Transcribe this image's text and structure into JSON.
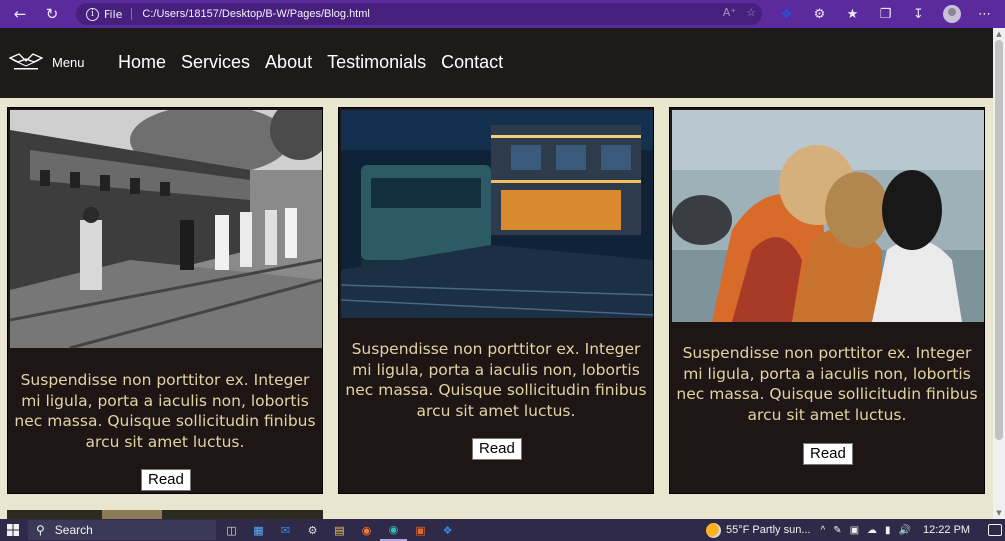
{
  "browser": {
    "file_label": "File",
    "url": "C:/Users/18157/Desktop/B-W/Pages/Blog.html",
    "icons": [
      "back-icon",
      "refresh-icon",
      "info-icon",
      "read-aloud-icon",
      "favorite-add-icon",
      "extension-icon",
      "extensions-icon",
      "favorites-icon",
      "collections-icon",
      "downloads-icon",
      "profile-icon",
      "more-icon"
    ]
  },
  "header": {
    "menu_label": "Menu",
    "nav": [
      "Home",
      "Services",
      "About",
      "Testimonials",
      "Contact"
    ]
  },
  "cards": [
    {
      "text": "Suspendisse non porttitor ex. Integer mi ligula, porta a iaculis non, lobortis nec massa. Quisque sollicitudin finibus arcu sit amet luctus.",
      "button": "Read"
    },
    {
      "text": "Suspendisse non porttitor ex. Integer mi ligula, porta a iaculis non, lobortis nec massa. Quisque sollicitudin finibus arcu sit amet luctus.",
      "button": "Read"
    },
    {
      "text": "Suspendisse non porttitor ex. Integer mi ligula, porta a iaculis non, lobortis nec massa. Quisque sollicitudin finibus arcu sit amet luctus.",
      "button": "Read"
    }
  ],
  "taskbar": {
    "search_placeholder": "Search",
    "weather": "55°F  Partly sun...",
    "time": "12:22 PM"
  },
  "colors": {
    "browser_accent": "#5b2a9c",
    "header_bg": "#1f1a1a",
    "page_bg": "#e9e6cf",
    "card_bg": "#1e1614",
    "card_text": "#e2d3a3"
  }
}
